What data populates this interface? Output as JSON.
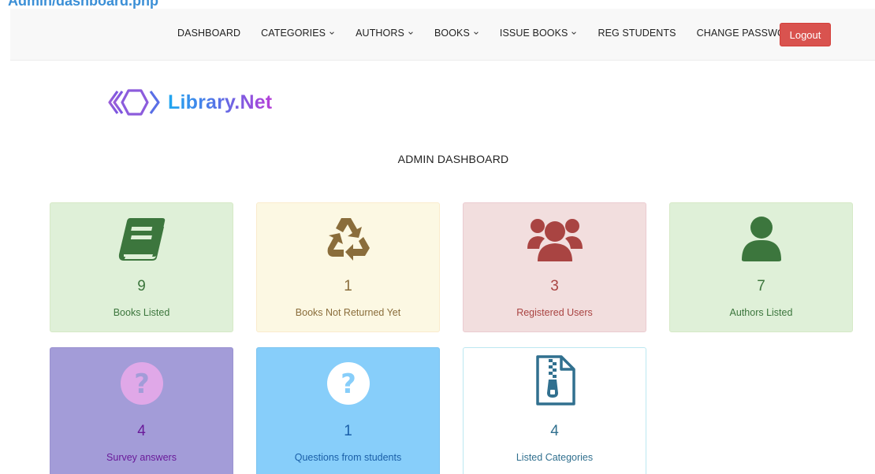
{
  "page_path": "Admin/dashboard.php",
  "nav": {
    "items": [
      {
        "label": "DASHBOARD",
        "dropdown": false
      },
      {
        "label": "CATEGORIES",
        "dropdown": true
      },
      {
        "label": "AUTHORS",
        "dropdown": true
      },
      {
        "label": "BOOKS",
        "dropdown": true
      },
      {
        "label": "ISSUE BOOKS",
        "dropdown": true
      },
      {
        "label": "REG STUDENTS",
        "dropdown": false
      },
      {
        "label": "CHANGE PASSWORD",
        "dropdown": false
      }
    ],
    "logout_label": "Logout"
  },
  "logo": {
    "text": "Library.Net"
  },
  "title": "ADMIN DASHBOARD",
  "cards": [
    {
      "count": "9",
      "label": "Books Listed",
      "icon": "book-icon",
      "color": "#3c763d"
    },
    {
      "count": "1",
      "label": "Books Not Returned Yet",
      "icon": "recycle-icon",
      "color": "#8a6d3b"
    },
    {
      "count": "3",
      "label": "Registered Users",
      "icon": "users-icon",
      "color": "#a94442"
    },
    {
      "count": "7",
      "label": "Authors Listed",
      "icon": "user-icon",
      "color": "#3c763d"
    },
    {
      "count": "4",
      "label": "Survey answers",
      "icon": "question-circle-icon",
      "color": "#e0a8e8"
    },
    {
      "count": "1",
      "label": "Questions from students",
      "icon": "question-circle-icon",
      "color": "#ffffff"
    },
    {
      "count": "4",
      "label": "Listed Categories",
      "icon": "file-archive-icon",
      "color": "#31708f"
    }
  ],
  "colors": {
    "logout": "#d9534f",
    "path": "#3b8fd6"
  }
}
